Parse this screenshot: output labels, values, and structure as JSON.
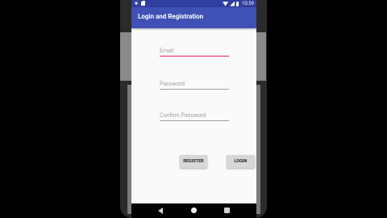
{
  "status_bar": {
    "time": "10:59",
    "icons": [
      "settings-icon",
      "sd-card-icon",
      "wifi-icon",
      "signal-icon",
      "battery-icon"
    ]
  },
  "app_bar": {
    "title": "Login and Registration",
    "color": "#3f51b5",
    "status_color": "#303f9f"
  },
  "form": {
    "email": {
      "placeholder": "Email",
      "value": ""
    },
    "password": {
      "placeholder": "Password",
      "value": ""
    },
    "confirm_password": {
      "placeholder": "Confirm Password",
      "value": ""
    },
    "focused_underline_color": "#e91e63"
  },
  "buttons": {
    "register_label": "REGISTER",
    "login_label": "LOGIN"
  },
  "nav": {
    "icons": [
      "back-icon",
      "home-icon",
      "recents-icon"
    ]
  }
}
